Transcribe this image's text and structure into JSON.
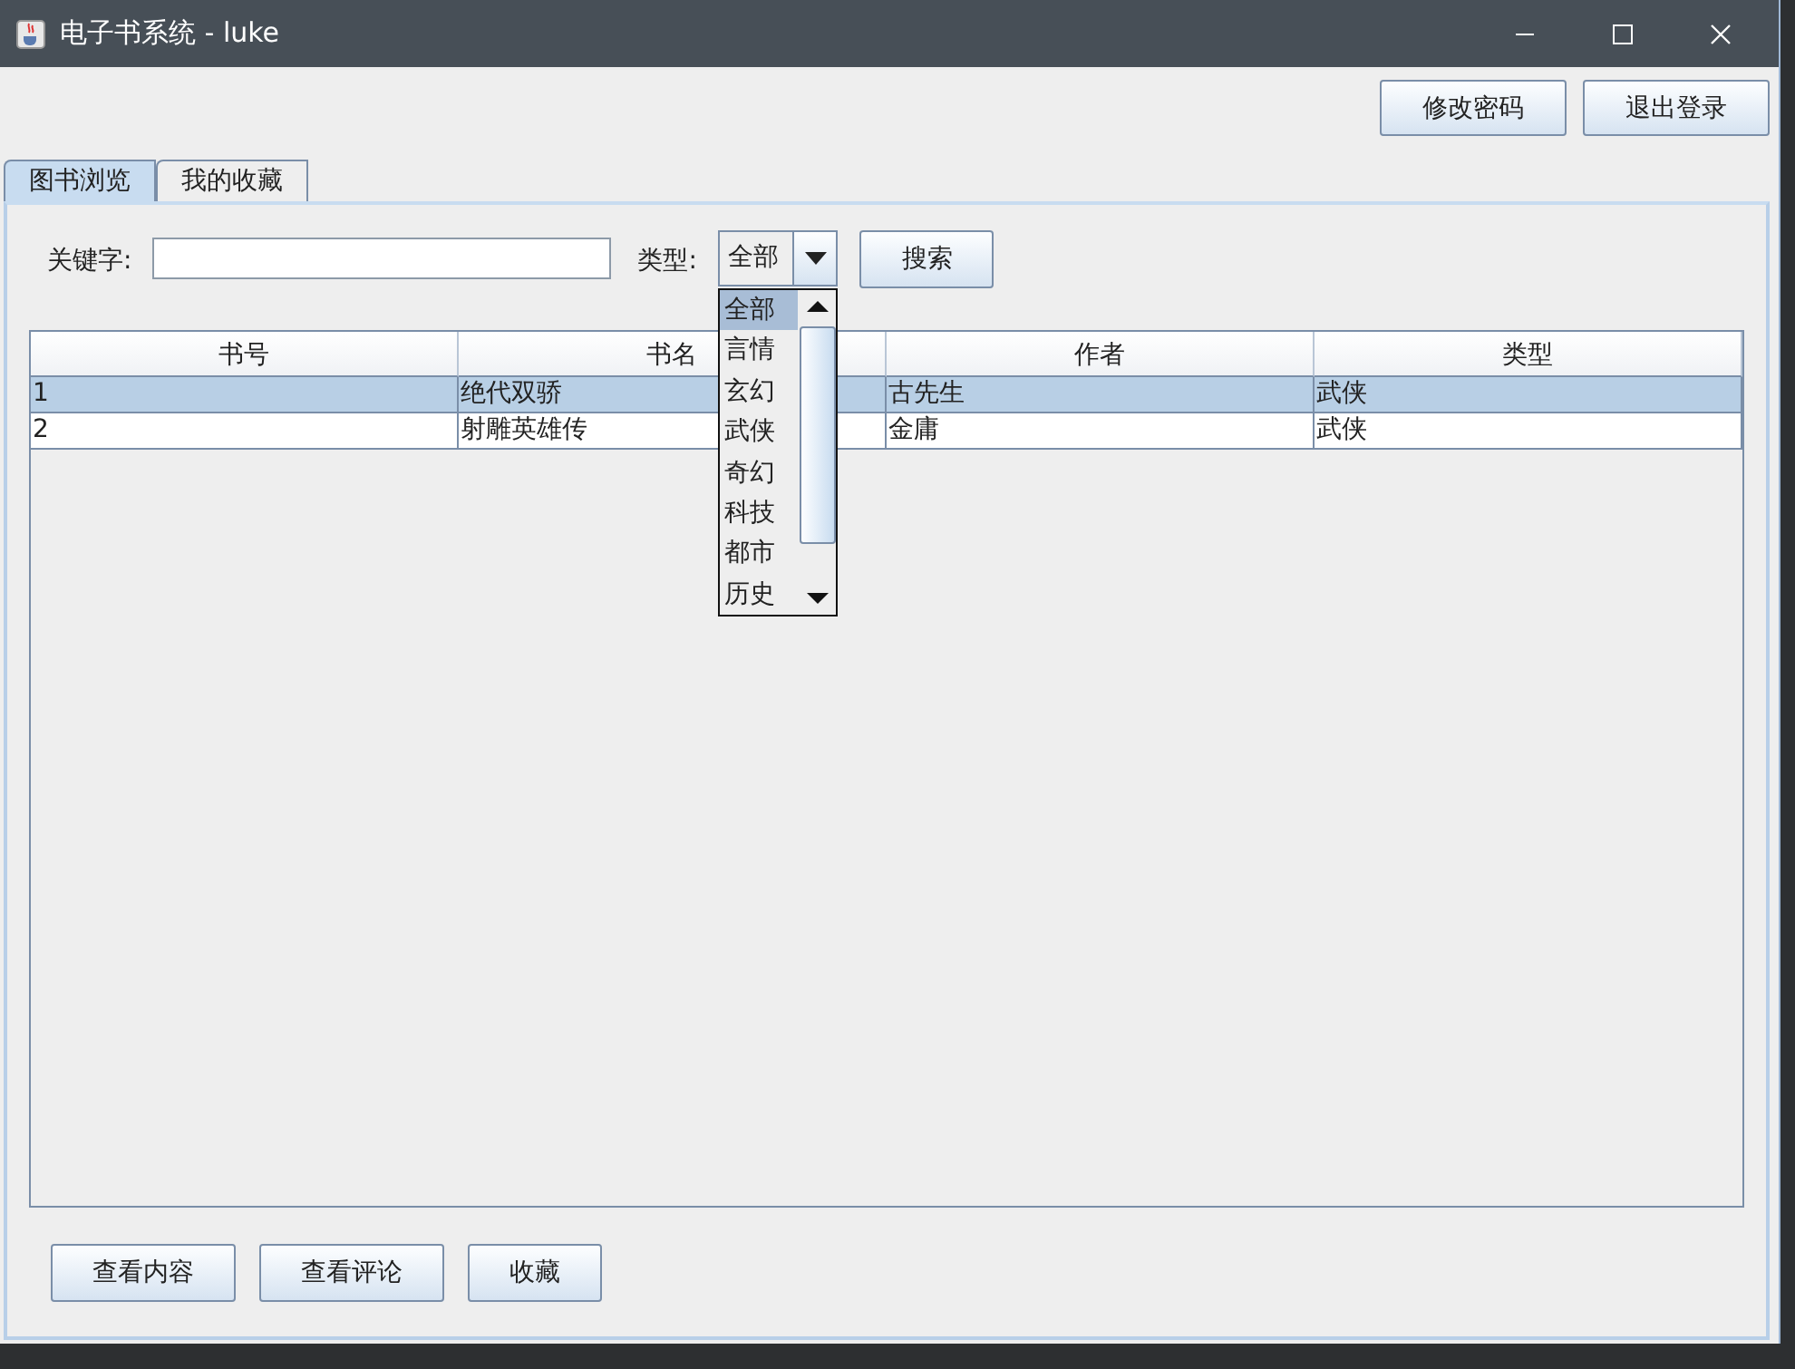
{
  "window": {
    "title": "电子书系统 - luke"
  },
  "top_buttons": [
    "修改密码",
    "退出登录"
  ],
  "tabs": [
    {
      "label": "图书浏览",
      "selected": true
    },
    {
      "label": "我的收藏",
      "selected": false
    }
  ],
  "search": {
    "keyword_label": "关键字:",
    "type_label": "类型:",
    "type_value": "全部",
    "search_button": "搜索"
  },
  "type_dropdown": {
    "expanded": true,
    "options": [
      {
        "label": "全部",
        "selected": true
      },
      {
        "label": "言情",
        "selected": false
      },
      {
        "label": "玄幻",
        "selected": false
      },
      {
        "label": "武侠",
        "selected": false
      },
      {
        "label": "奇幻",
        "selected": false
      },
      {
        "label": "科技",
        "selected": false
      },
      {
        "label": "都市",
        "selected": false
      },
      {
        "label": "历史",
        "selected": false
      }
    ]
  },
  "table": {
    "columns": [
      "书号",
      "书名",
      "作者",
      "类型"
    ],
    "rows": [
      {
        "cells": [
          "1",
          "绝代双骄",
          "古先生",
          "武侠"
        ],
        "selected": true
      },
      {
        "cells": [
          "2",
          "射雕英雄传",
          "金庸",
          "武侠"
        ],
        "selected": false
      }
    ]
  },
  "bottom_buttons": [
    "查看内容",
    "查看评论",
    "收藏"
  ]
}
